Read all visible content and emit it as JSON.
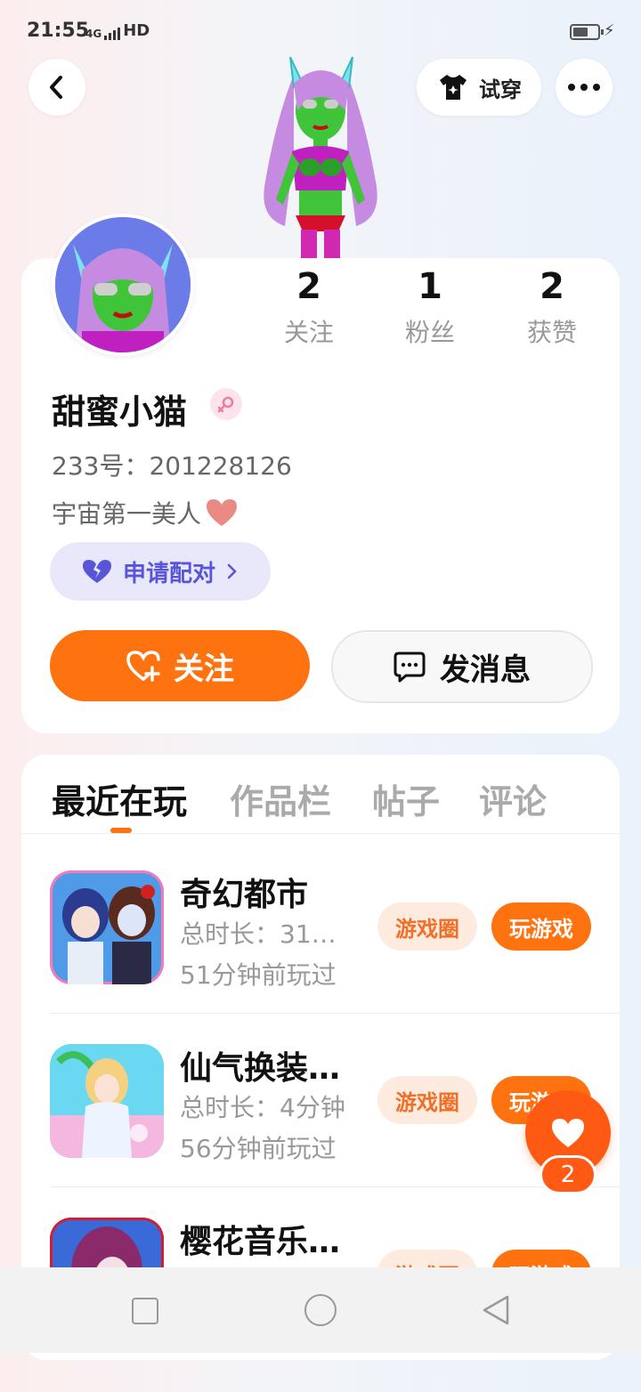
{
  "status_bar": {
    "time": "21:55",
    "network": "4G",
    "hd": "HD"
  },
  "header": {
    "tryon_label": "试穿"
  },
  "profile": {
    "stats": [
      {
        "value": "2",
        "label": "关注"
      },
      {
        "value": "1",
        "label": "粉丝"
      },
      {
        "value": "2",
        "label": "获赞"
      }
    ],
    "username": "甜蜜小猫",
    "gender": "female",
    "uid": "233号：201228126",
    "bio": "宇宙第一美人",
    "pair_button": "申请配对",
    "follow_button": "关注",
    "message_button": "发消息"
  },
  "tabs": [
    "最近在玩",
    "作品栏",
    "帖子",
    "评论"
  ],
  "active_tab": "最近在玩",
  "games": [
    {
      "name": "奇幻都市",
      "duration": "总时长：31…",
      "last_played": "51分钟前玩过",
      "circle_label": "游戏圈",
      "play_label": "玩游戏"
    },
    {
      "name": "仙气换装…",
      "duration": "总时长：4分钟",
      "last_played": "56分钟前玩过",
      "circle_label": "游戏圈",
      "play_label": "玩游戏"
    },
    {
      "name": "樱花音乐…",
      "duration": "",
      "last_played": "",
      "circle_label": "游戏圈",
      "play_label": "玩游戏"
    }
  ],
  "like_count": "2",
  "colors": {
    "accent": "#ff7210",
    "like": "#ff5a14",
    "pair": "#5a55d8"
  }
}
